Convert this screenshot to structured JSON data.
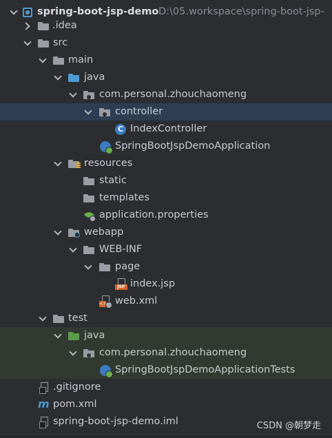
{
  "project": {
    "name": "spring-boot-jsp-demo",
    "path": "D:\\05.workspace\\spring-boot-jsp-"
  },
  "tree": {
    "idea": ".idea",
    "src": "src",
    "main": "main",
    "java": "java",
    "package": "com.personal.zhouchaomeng",
    "controller": "controller",
    "index_controller": "IndexController",
    "app_class": "SpringBootJspDemoApplication",
    "resources": "resources",
    "static": "static",
    "templates": "templates",
    "app_properties": "application.properties",
    "webapp": "webapp",
    "web_inf": "WEB-INF",
    "page": "page",
    "index_jsp": "index.jsp",
    "web_xml": "web.xml",
    "test": "test",
    "test_java": "java",
    "test_package": "com.personal.zhouchaomeng",
    "test_class": "SpringBootJspDemoApplicationTests",
    "gitignore": ".gitignore",
    "pom": "pom.xml",
    "iml": "spring-boot-jsp-demo.iml"
  },
  "watermark": "CSDN @朝梦走",
  "colors": {
    "background": "#2b2d30",
    "selected_row": "#2d3e53",
    "test_row": "#323930",
    "source_folder": "#4e9ad1",
    "test_folder": "#5d9c4a"
  }
}
